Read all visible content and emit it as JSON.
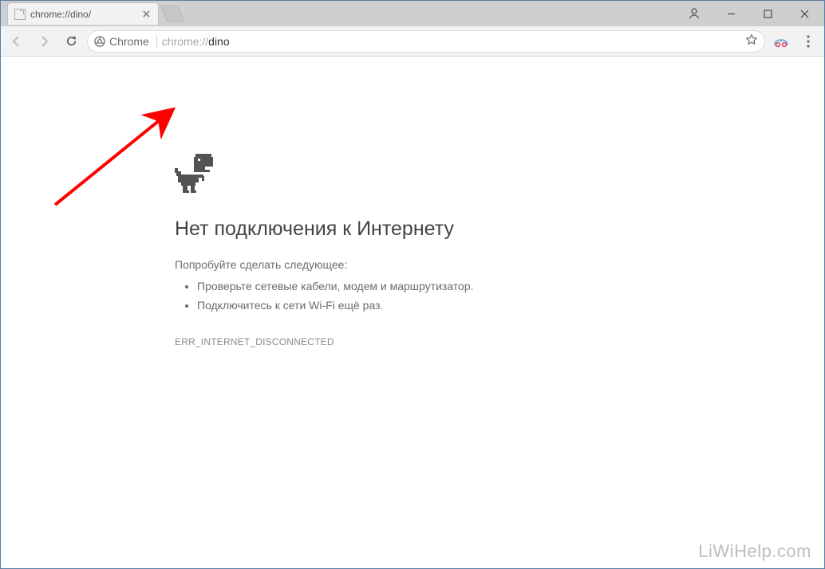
{
  "tab": {
    "title": "chrome://dino/"
  },
  "omnibox": {
    "chip_label": "Chrome",
    "url_scheme": "chrome://",
    "url_path": "dino"
  },
  "error": {
    "title": "Нет подключения к Интернету",
    "intro": "Попробуйте сделать следующее:",
    "bullets": [
      "Проверьте сетевые кабели, модем и маршрутизатор.",
      "Подключитесь к сети Wi-Fi ещё раз."
    ],
    "code": "ERR_INTERNET_DISCONNECTED"
  },
  "watermark": "LiWiHelp.com"
}
